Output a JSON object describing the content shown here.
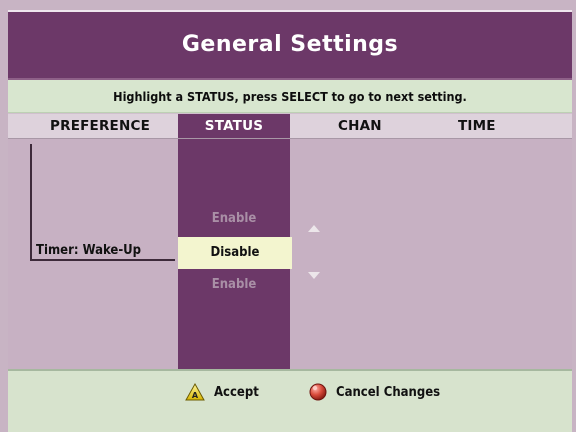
{
  "title": "General Settings",
  "instruction": "Highlight a STATUS, press SELECT to go to next setting.",
  "columns": {
    "preference": "PREFERENCE",
    "status": "STATUS",
    "chan": "CHAN",
    "time": "TIME"
  },
  "row": {
    "preference": "Timer: Wake-Up",
    "status_options": {
      "above": "Enable",
      "selected": "Disable",
      "below": "Enable"
    }
  },
  "footer": {
    "accept_label": "Accept",
    "cancel_label": "Cancel Changes",
    "accept_icon": "yellow-triangle-icon",
    "cancel_icon": "red-circle-icon"
  },
  "colors": {
    "title_bar": "#6c3868",
    "status_column": "#6c3868",
    "instruction_bg": "#d8e6cf",
    "selected_bg": "#f3f5cf",
    "footer_bg": "#d7e3cd"
  }
}
